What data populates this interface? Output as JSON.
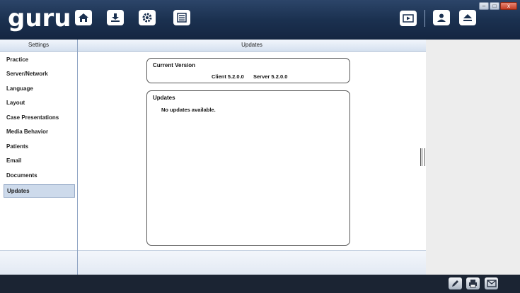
{
  "app": {
    "logo": "guru"
  },
  "toolbar": {
    "left_icons": [
      "home-icon",
      "download-icon",
      "gear-icon",
      "list-icon"
    ],
    "right_icons": [
      "presentation-icon",
      "user-icon",
      "eject-icon"
    ]
  },
  "window_controls": {
    "minimize": "–",
    "maximize": "□",
    "close": "x"
  },
  "settings_header": "Settings",
  "main_header": "Updates",
  "sidebar": {
    "items": [
      {
        "label": "Practice"
      },
      {
        "label": "Server/Network"
      },
      {
        "label": "Language"
      },
      {
        "label": "Layout"
      },
      {
        "label": "Case Presentations"
      },
      {
        "label": "Media Behavior"
      },
      {
        "label": "Patients"
      },
      {
        "label": "Email"
      },
      {
        "label": "Documents"
      },
      {
        "label": "Updates",
        "selected": true
      }
    ]
  },
  "current_version": {
    "title": "Current Version",
    "client": "Client 5.2.0.0",
    "server": "Server 5.2.0.0"
  },
  "updates_box": {
    "title": "Updates",
    "message": "No updates available."
  },
  "bottom_icons": [
    "edit-icon",
    "print-icon",
    "mail-icon"
  ]
}
